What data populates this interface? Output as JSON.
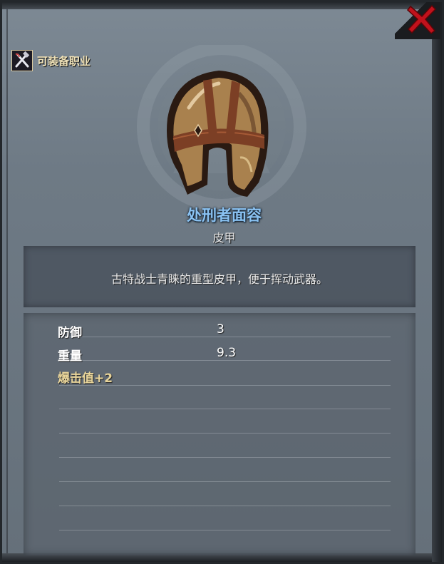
{
  "header": {
    "class_label": "可装备职业",
    "class_icon": "crossed-tools-icon",
    "close_icon": "close-x-icon"
  },
  "item": {
    "name": "处刑者面容",
    "type": "皮甲",
    "icon": "leather-helmet-icon",
    "description": "古特战士青睐的重型皮甲，便于挥动武器。"
  },
  "stats": [
    {
      "label": "防御",
      "value": "3"
    },
    {
      "label": "重量",
      "value": "9.3"
    }
  ],
  "bonus": {
    "text": "爆击值+2"
  },
  "colors": {
    "name": "#8ac2f2",
    "bonus": "#e9d59a",
    "close": "#c0121c"
  }
}
